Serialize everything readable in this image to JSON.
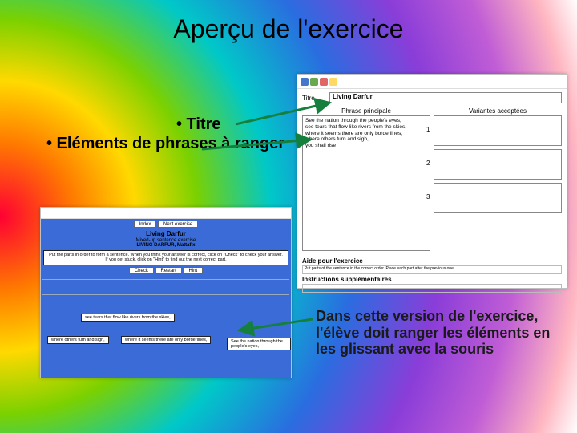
{
  "title": "Aperçu de l'exercice",
  "bullets": {
    "titre": "• Titre",
    "elements": "• Eléments de phrases à ranger"
  },
  "description": "Dans cette version de l'exercice, l'élève doit ranger les éléments en les glissant avec la souris",
  "app_window": {
    "titre_label": "Titre",
    "titre_value": "Living Darfur",
    "left_col_header": "Phrase principale",
    "left_textarea": "See the nation through the people's eyes,\nsee tears that flow like rivers from the skies,\nwhere it seems there are only borderlines,\nwhere others turn and sigh,\nyou shall rise",
    "right_col_header": "Variantes acceptées",
    "vars": [
      "1",
      "2",
      "3"
    ],
    "bottom": {
      "aide_label": "Aide pour l'exercice",
      "aide_text": "Put parts of the sentence in the correct order. Place each part after the previous one.",
      "other_label": "Instructions supplémentaires"
    }
  },
  "browser": {
    "nav": {
      "index": "Index",
      "next": "Next exercise"
    },
    "ex_title": "Living Darfur",
    "subtitle": "Mixed-up sentence exercise",
    "subtitle2": "LIVING DARFUR, Mattafix",
    "instructions": "Put the parts in order to form a sentence. When you think your answer is correct, click on \"Check\" to check your answer. If you get stuck, click on \"Hint\" to find out the next correct part.",
    "controls": {
      "check": "Check",
      "restart": "Restart",
      "hint": "Hint"
    },
    "chips": {
      "a": "see tears that flow like rivers from the skies,",
      "b": "where others turn and sigh,",
      "c": "where it seems there are only borderlines,",
      "d": "See the nation through the people's eyes,"
    }
  }
}
